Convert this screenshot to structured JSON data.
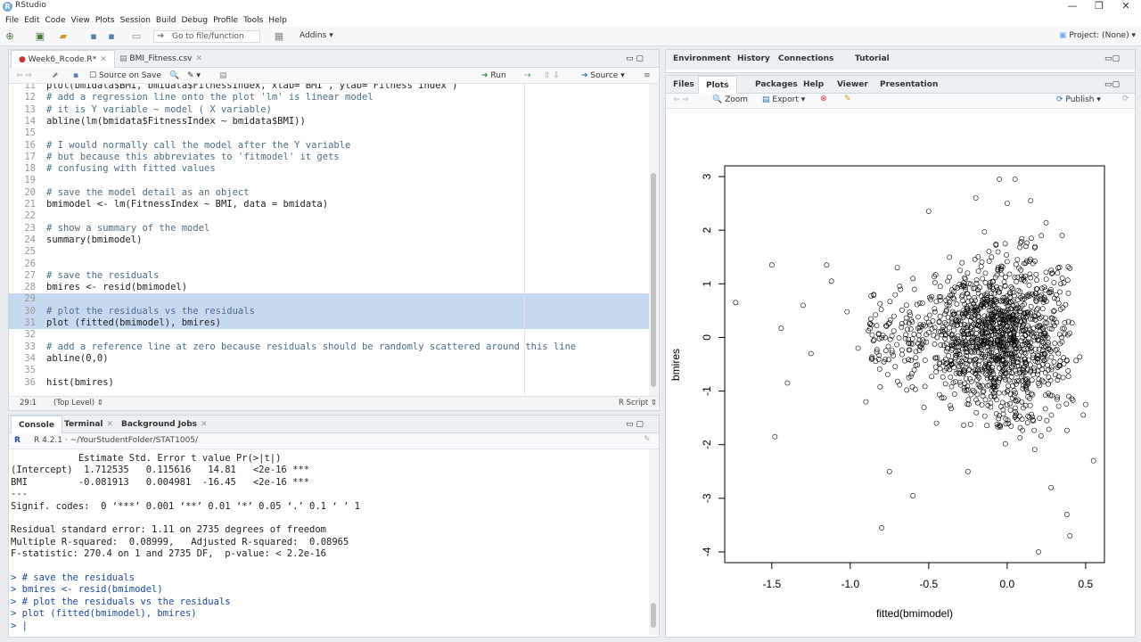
{
  "window": {
    "title": "RStudio",
    "controls": [
      "—",
      "❐",
      "✕"
    ]
  },
  "menu": [
    "File",
    "Edit",
    "Code",
    "View",
    "Plots",
    "Session",
    "Build",
    "Debug",
    "Profile",
    "Tools",
    "Help"
  ],
  "toolbar": {
    "goto_placeholder": "Go to file/function",
    "addins": "Addins",
    "project": "Project: (None)"
  },
  "editor": {
    "tabs": [
      {
        "label": "Week6_Rcode.R*",
        "active": true
      },
      {
        "label": "BMI_Fitness.csv",
        "active": false
      }
    ],
    "source_on_save": "Source on Save",
    "run_label": "Run",
    "source_label": "Source",
    "lines": [
      {
        "n": "11",
        "t": "plot(bmidata$BMI, bmidata$FitnessIndex, xlab=\"BMI\", ylab=\"Fitness Index\")",
        "c": false,
        "s": false
      },
      {
        "n": "12",
        "t": "# add a regression line onto the plot 'lm' is linear model",
        "c": true,
        "s": false
      },
      {
        "n": "13",
        "t": "# it is Y variable ~ model ( X variable)",
        "c": true,
        "s": false
      },
      {
        "n": "14",
        "t": "abline(lm(bmidata$FitnessIndex ~ bmidata$BMI))",
        "c": false,
        "s": false
      },
      {
        "n": "15",
        "t": "",
        "c": false,
        "s": false
      },
      {
        "n": "16",
        "t": "# I would normally call the model after the Y variable",
        "c": true,
        "s": false
      },
      {
        "n": "17",
        "t": "# but because this abbreviates to 'fitmodel' it gets",
        "c": true,
        "s": false
      },
      {
        "n": "18",
        "t": "# confusing with fitted values",
        "c": true,
        "s": false
      },
      {
        "n": "19",
        "t": "",
        "c": false,
        "s": false
      },
      {
        "n": "20",
        "t": "# save the model detail as an object",
        "c": true,
        "s": false
      },
      {
        "n": "21",
        "t": "bmimodel <- lm(FitnessIndex ~ BMI, data = bmidata)",
        "c": false,
        "s": false
      },
      {
        "n": "22",
        "t": "",
        "c": false,
        "s": false
      },
      {
        "n": "23",
        "t": "# show a summary of the model",
        "c": true,
        "s": false
      },
      {
        "n": "24",
        "t": "summary(bmimodel)",
        "c": false,
        "s": false
      },
      {
        "n": "25",
        "t": "",
        "c": false,
        "s": false
      },
      {
        "n": "26",
        "t": "",
        "c": false,
        "s": false
      },
      {
        "n": "27",
        "t": "# save the residuals",
        "c": true,
        "s": false
      },
      {
        "n": "28",
        "t": "bmires <- resid(bmimodel)",
        "c": false,
        "s": false
      },
      {
        "n": "29",
        "t": "",
        "c": false,
        "s": true
      },
      {
        "n": "30",
        "t": "# plot the residuals vs the residuals",
        "c": true,
        "s": true
      },
      {
        "n": "31",
        "t": "plot (fitted(bmimodel), bmires)",
        "c": false,
        "s": true
      },
      {
        "n": "32",
        "t": "",
        "c": false,
        "s": false
      },
      {
        "n": "33",
        "t": "# add a reference line at zero because residuals should be randomly scattered around this line",
        "c": true,
        "s": false
      },
      {
        "n": "34",
        "t": "abline(0,0)",
        "c": false,
        "s": false
      },
      {
        "n": "35",
        "t": "",
        "c": false,
        "s": false
      },
      {
        "n": "36",
        "t": "hist(bmires)",
        "c": false,
        "s": false
      }
    ],
    "status": {
      "position": "29:1",
      "scope": "(Top Level) ⇕",
      "type": "R Script ⇕"
    }
  },
  "console": {
    "tabs": [
      "Console",
      "Terminal",
      "Background Jobs"
    ],
    "path": "R 4.2.1 · ~/YourStudentFolder/STAT1005/",
    "lines": [
      {
        "t": "            Estimate Std. Error t value Pr(>|t|)    ",
        "cmd": false
      },
      {
        "t": "(Intercept)  1.712535   0.115616   14.81   <2e-16 ***",
        "cmd": false
      },
      {
        "t": "BMI         -0.081913   0.004981  -16.45   <2e-16 ***",
        "cmd": false
      },
      {
        "t": "---",
        "cmd": false
      },
      {
        "t": "Signif. codes:  0 ‘***’ 0.001 ‘**’ 0.01 ‘*’ 0.05 ‘.’ 0.1 ‘ ’ 1",
        "cmd": false
      },
      {
        "t": "",
        "cmd": false
      },
      {
        "t": "Residual standard error: 1.11 on 2735 degrees of freedom",
        "cmd": false
      },
      {
        "t": "Multiple R-squared:  0.08999,\tAdjusted R-squared:  0.08965 ",
        "cmd": false
      },
      {
        "t": "F-statistic: 270.4 on 1 and 2735 DF,  p-value: < 2.2e-16",
        "cmd": false
      },
      {
        "t": "",
        "cmd": false
      },
      {
        "t": "> # save the residuals",
        "cmd": true
      },
      {
        "t": "> bmires <- resid(bmimodel)",
        "cmd": true
      },
      {
        "t": "> # plot the residuals vs the residuals",
        "cmd": true
      },
      {
        "t": "> plot (fitted(bmimodel), bmires)",
        "cmd": true
      },
      {
        "t": "> |",
        "cmd": true
      }
    ]
  },
  "env_tabs": [
    "Environment",
    "History",
    "Connections",
    "Tutorial"
  ],
  "files_tabs": [
    "Files",
    "Plots",
    "Packages",
    "Help",
    "Viewer",
    "Presentation"
  ],
  "plot_toolbar": {
    "zoom": "Zoom",
    "export": "Export ▾",
    "publish": "Publish ▾"
  },
  "colors": {
    "selection": "#c7d9f0",
    "comment": "#4d6e87",
    "accent": "#75aadb"
  },
  "chart_data": {
    "type": "scatter",
    "title": "",
    "xlabel": "fitted(bmimodel)",
    "ylabel": "bmires",
    "xlim": [
      -1.8,
      0.62
    ],
    "ylim": [
      -4.2,
      3.2
    ],
    "xticks": [
      "-1.5",
      "-1.0",
      "-0.5",
      "0.0",
      "0.5"
    ],
    "xtick_values": [
      -1.5,
      -1.0,
      -0.5,
      0.0,
      0.5
    ],
    "yticks": [
      "-4",
      "-3",
      "-2",
      "-1",
      "0",
      "1",
      "2",
      "3"
    ],
    "ytick_values": [
      -4,
      -3,
      -2,
      -1,
      0,
      1,
      2,
      3
    ],
    "n_points": 2737,
    "marker": "open-circle",
    "points": [
      [
        -1.73,
        0.65
      ],
      [
        -1.5,
        1.35
      ],
      [
        -1.48,
        -1.85
      ],
      [
        -1.44,
        0.17
      ],
      [
        -1.4,
        -0.85
      ],
      [
        -1.3,
        0.6
      ],
      [
        -1.15,
        1.35
      ],
      [
        -1.12,
        1.05
      ],
      [
        -1.02,
        0.48
      ],
      [
        -0.95,
        -0.2
      ],
      [
        -0.9,
        -1.2
      ],
      [
        -0.85,
        0.8
      ],
      [
        -0.8,
        -3.55
      ],
      [
        -0.75,
        -2.5
      ],
      [
        -0.7,
        1.3
      ],
      [
        -0.6,
        -2.95
      ],
      [
        -0.5,
        2.35
      ],
      [
        -0.45,
        -1.6
      ],
      [
        -0.3,
        1.25
      ],
      [
        -0.25,
        -2.5
      ],
      [
        -0.2,
        2.6
      ],
      [
        -0.1,
        1.5
      ],
      [
        -0.05,
        2.95
      ],
      [
        0.0,
        2.5
      ],
      [
        0.05,
        2.95
      ],
      [
        0.1,
        -0.7
      ],
      [
        0.15,
        2.55
      ],
      [
        0.2,
        -4.0
      ],
      [
        0.28,
        -2.8
      ],
      [
        0.35,
        1.9
      ],
      [
        0.38,
        -3.3
      ],
      [
        0.4,
        -3.7
      ],
      [
        0.5,
        -1.25
      ],
      [
        0.55,
        -2.3
      ],
      [
        -0.35,
        0.8
      ],
      [
        -0.15,
        -1.0
      ],
      [
        0.0,
        -0.3
      ],
      [
        -0.6,
        1.1
      ],
      [
        0.3,
        0.5
      ],
      [
        -1.25,
        -0.3
      ]
    ]
  }
}
